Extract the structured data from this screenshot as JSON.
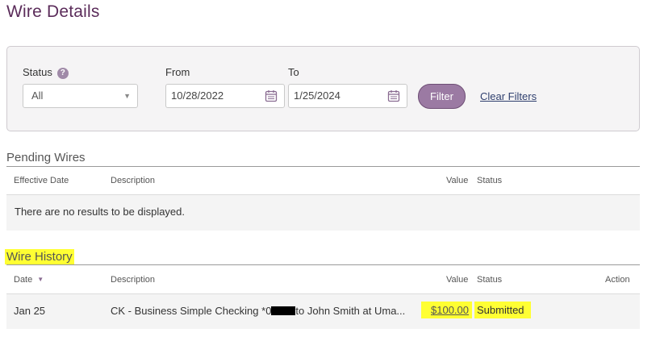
{
  "page": {
    "title": "Wire Details"
  },
  "filters": {
    "status_label": "Status",
    "status_value": "All",
    "from_label": "From",
    "from_value": "10/28/2022",
    "to_label": "To",
    "to_value": "1/25/2024",
    "filter_button": "Filter",
    "clear_filters": "Clear Filters",
    "help_icon": "question-circle-icon"
  },
  "pending": {
    "title": "Pending Wires",
    "columns": {
      "date": "Effective Date",
      "description": "Description",
      "value": "Value",
      "status": "Status"
    },
    "empty_message": "There are no results to be displayed."
  },
  "history": {
    "title": "Wire History",
    "columns": {
      "date": "Date",
      "description": "Description",
      "value": "Value",
      "status": "Status",
      "action": "Action"
    },
    "rows": [
      {
        "date": "Jan 25",
        "description_prefix": "CK - Business Simple Checking *0",
        "description_suffix": "to John Smith at Uma...",
        "value": "$100.00",
        "status": "Submitted"
      }
    ]
  },
  "colors": {
    "title": "#5b2c5a",
    "accent": "#9b7aa3",
    "highlight": "#ffff33",
    "link": "#2f3f6e"
  }
}
